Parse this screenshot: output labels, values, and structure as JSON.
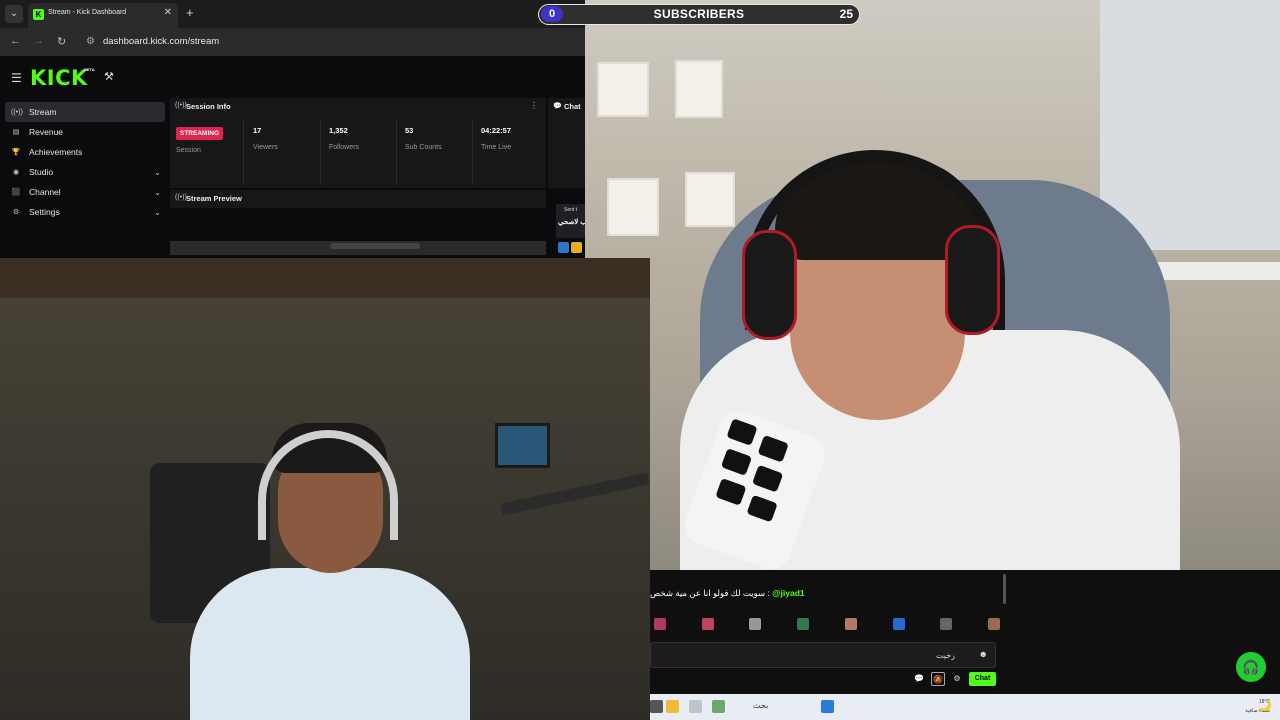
{
  "browser": {
    "tab_title": "Stream - Kick Dashboard",
    "tab_close": "✕",
    "new_tab": "+",
    "url": "dashboard.kick.com/stream"
  },
  "dashboard": {
    "logo": "KICK",
    "logo_badge": "BETA",
    "sidebar": [
      {
        "label": "Stream",
        "icon": "stream-icon",
        "active": true
      },
      {
        "label": "Revenue",
        "icon": "revenue-icon"
      },
      {
        "label": "Achievements",
        "icon": "trophy-icon"
      },
      {
        "label": "Studio",
        "icon": "studio-icon",
        "expandable": true
      },
      {
        "label": "Channel",
        "icon": "channel-icon",
        "expandable": true
      },
      {
        "label": "Settings",
        "icon": "gear-icon",
        "expandable": true
      }
    ],
    "session_info": {
      "title": "Session Info",
      "status_badge": "STREAMING",
      "session_label": "Session",
      "stats": [
        {
          "value": "17",
          "label": "Viewers"
        },
        {
          "value": "1,352",
          "label": "Followers"
        },
        {
          "value": "53",
          "label": "Sub Counts"
        },
        {
          "value": "04:22:57",
          "label": "Time Live"
        }
      ]
    },
    "chat_panel_title": "Chat",
    "stream_preview_title": "Stream Preview",
    "chat_snippet_meta": "Sent t",
    "chat_snippet_text": "ب لاصحي"
  },
  "subscriber_goal": {
    "current": "0",
    "label": "SUBSCRIBERS",
    "goal": "25",
    "progress": 0.0,
    "fill_color": "#3a34c9"
  },
  "chat_overlay": {
    "message_user": "@jiyad1",
    "message_text": "سويت لك فولو انا عن مية شخص :",
    "input_value": "زخيت",
    "send_label": "Chat",
    "emotes": [
      "#b03a5a",
      "#c0445e",
      "#999999",
      "#2f7d4a",
      "#b07a66",
      "#2a6ad0",
      "#666666",
      "#9a6a55"
    ]
  },
  "taskbar": {
    "search_placeholder": "بحث",
    "weather_temp": "18°C",
    "weather_desc": "سماء صافية"
  },
  "colors": {
    "kick_green": "#53fc18",
    "streaming_red": "#e0244f"
  }
}
